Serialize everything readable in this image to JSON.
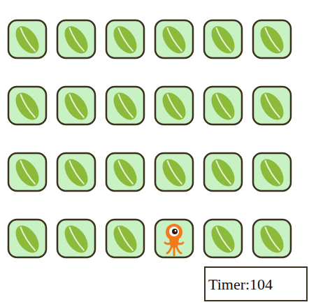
{
  "grid": {
    "rows": [
      [
        {
          "kind": "leaf"
        },
        {
          "kind": "leaf"
        },
        {
          "kind": "leaf"
        },
        {
          "kind": "leaf"
        },
        {
          "kind": "leaf"
        },
        {
          "kind": "leaf"
        }
      ],
      [
        {
          "kind": "leaf"
        },
        {
          "kind": "leaf"
        },
        {
          "kind": "leaf"
        },
        {
          "kind": "leaf"
        },
        {
          "kind": "leaf"
        },
        {
          "kind": "leaf"
        }
      ],
      [
        {
          "kind": "leaf"
        },
        {
          "kind": "leaf"
        },
        {
          "kind": "leaf"
        },
        {
          "kind": "leaf"
        },
        {
          "kind": "leaf"
        },
        {
          "kind": "leaf"
        }
      ],
      [
        {
          "kind": "leaf"
        },
        {
          "kind": "leaf"
        },
        {
          "kind": "leaf"
        },
        {
          "kind": "creature"
        },
        {
          "kind": "leaf"
        },
        {
          "kind": "leaf"
        }
      ]
    ]
  },
  "timer": "Timer:104"
}
